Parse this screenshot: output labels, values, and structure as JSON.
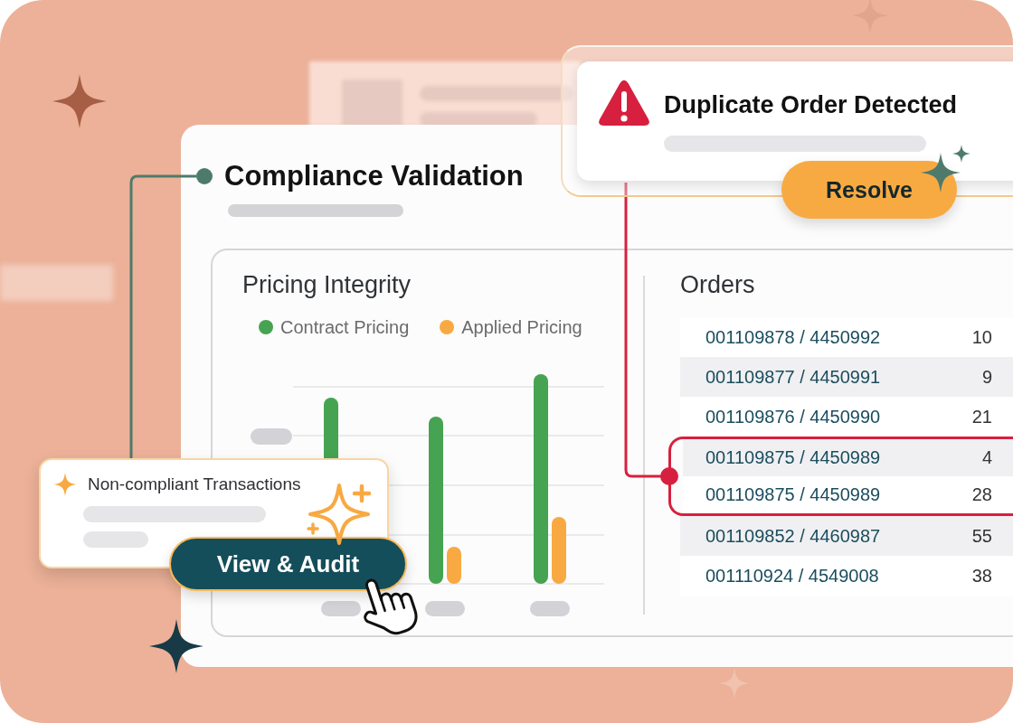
{
  "main_card": {
    "title": "Compliance Validation",
    "pricing_panel": {
      "title": "Pricing Integrity",
      "legend": [
        {
          "label": "Contract Pricing",
          "color": "#46a352"
        },
        {
          "label": "Applied Pricing",
          "color": "#f8a942"
        }
      ]
    },
    "orders_panel": {
      "title": "Orders",
      "rows": [
        {
          "column_1": "001109878 / 4450992",
          "column_2": "10",
          "flagged": false
        },
        {
          "column_1": "001109877 / 4450991",
          "column_2": "9",
          "flagged": false
        },
        {
          "column_1": "001109876 / 4450990",
          "column_2": "21",
          "flagged": false
        },
        {
          "column_1": "001109875 / 4450989",
          "column_2": "4",
          "flagged": true
        },
        {
          "column_1": "001109875 / 4450989",
          "column_2": "28",
          "flagged": true
        },
        {
          "column_1": "001109852 / 4460987",
          "column_2": "55",
          "flagged": false
        },
        {
          "column_1": "001110924 / 4549008",
          "column_2": "38",
          "flagged": false
        }
      ]
    }
  },
  "alert": {
    "title": "Duplicate Order Detected",
    "action": "Resolve"
  },
  "insight_card": {
    "title": "Non-compliant Transactions",
    "action": "View & Audit"
  }
}
